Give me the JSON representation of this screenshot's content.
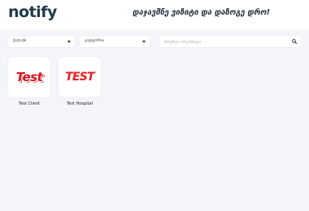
{
  "header": {
    "logo": "notify",
    "tagline": "დაჯავშნე ვიზიტი და დაზოგე დრო!"
  },
  "filters": {
    "city_select": {
      "selected": "ქალაქი"
    },
    "category_select": {
      "selected": "კატეგორია"
    },
    "search": {
      "placeholder": "მოძებნეთ ორგანიზაცია"
    }
  },
  "organizations": [
    {
      "name": "Test Client",
      "logo_text": "Test",
      "logo_color": "#d3131b"
    },
    {
      "name": "Test Hospital",
      "logo_text": "TEST",
      "logo_color": "#ee1c24"
    }
  ]
}
